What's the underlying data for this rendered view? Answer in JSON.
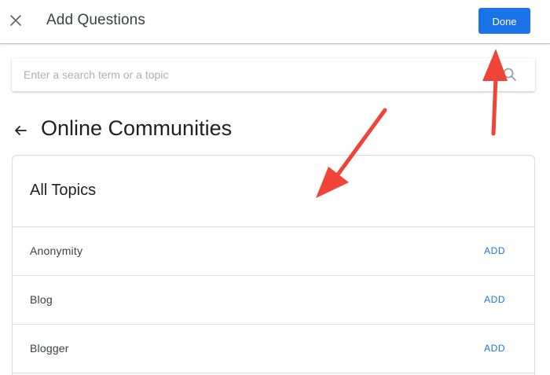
{
  "header": {
    "close_icon": "close-icon",
    "title": "Add Questions",
    "done_label": "Done"
  },
  "search": {
    "placeholder": "Enter a search term or a topic",
    "value": "",
    "icon": "search-icon"
  },
  "page": {
    "back_icon": "arrow-left-icon",
    "title": "Online Communities"
  },
  "topics_card": {
    "title": "All Topics",
    "items": [
      {
        "label": "Anonymity",
        "action": "ADD"
      },
      {
        "label": "Blog",
        "action": "ADD"
      },
      {
        "label": "Blogger",
        "action": "ADD"
      }
    ]
  },
  "colors": {
    "accent": "#1a73e8",
    "annotation_arrow": "#f04438"
  }
}
